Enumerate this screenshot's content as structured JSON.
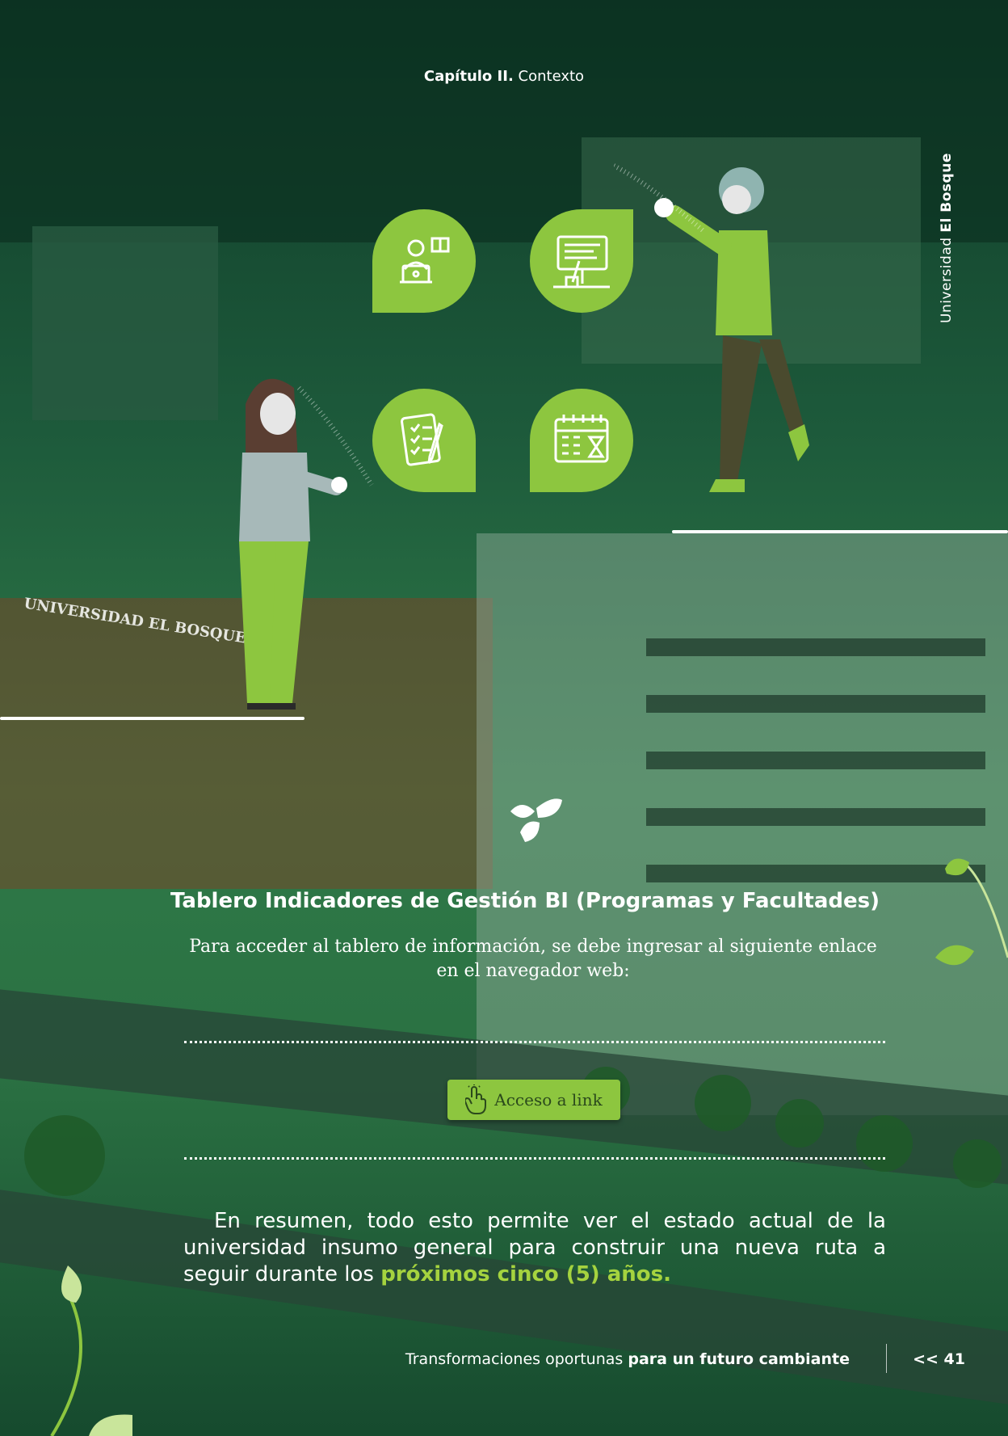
{
  "header": {
    "chapter_bold": "Capítulo II.",
    "chapter_rest": "Contexto"
  },
  "side_label": {
    "regular": "Universidad",
    "bold": "El Bosque"
  },
  "photo_sign": "UNIVERSIDAD EL BOSQUE",
  "icons": [
    "student-laptop-icon",
    "presentation-board-icon",
    "checklist-icon",
    "calendar-hourglass-icon"
  ],
  "section": {
    "title": "Tablero Indicadores de Gestión BI (Programas y Facultades)",
    "description": "Para acceder al tablero de información, se debe ingresar al siguiente enlace en el navegador web:",
    "button_label": "Acceso a link"
  },
  "summary": {
    "text_regular": "En resumen, todo esto permite ver el estado actual de la universidad insumo general para construir una nueva ruta a seguir durante los ",
    "text_highlight": "próximos cinco (5) años."
  },
  "footer": {
    "regular": "Transformaciones oportunas ",
    "bold": "para un futuro cambiante",
    "page": "<< 41"
  },
  "colors": {
    "accent_green": "#8dc63f",
    "dark_green": "#164a2e",
    "highlight": "#a5d33f"
  }
}
